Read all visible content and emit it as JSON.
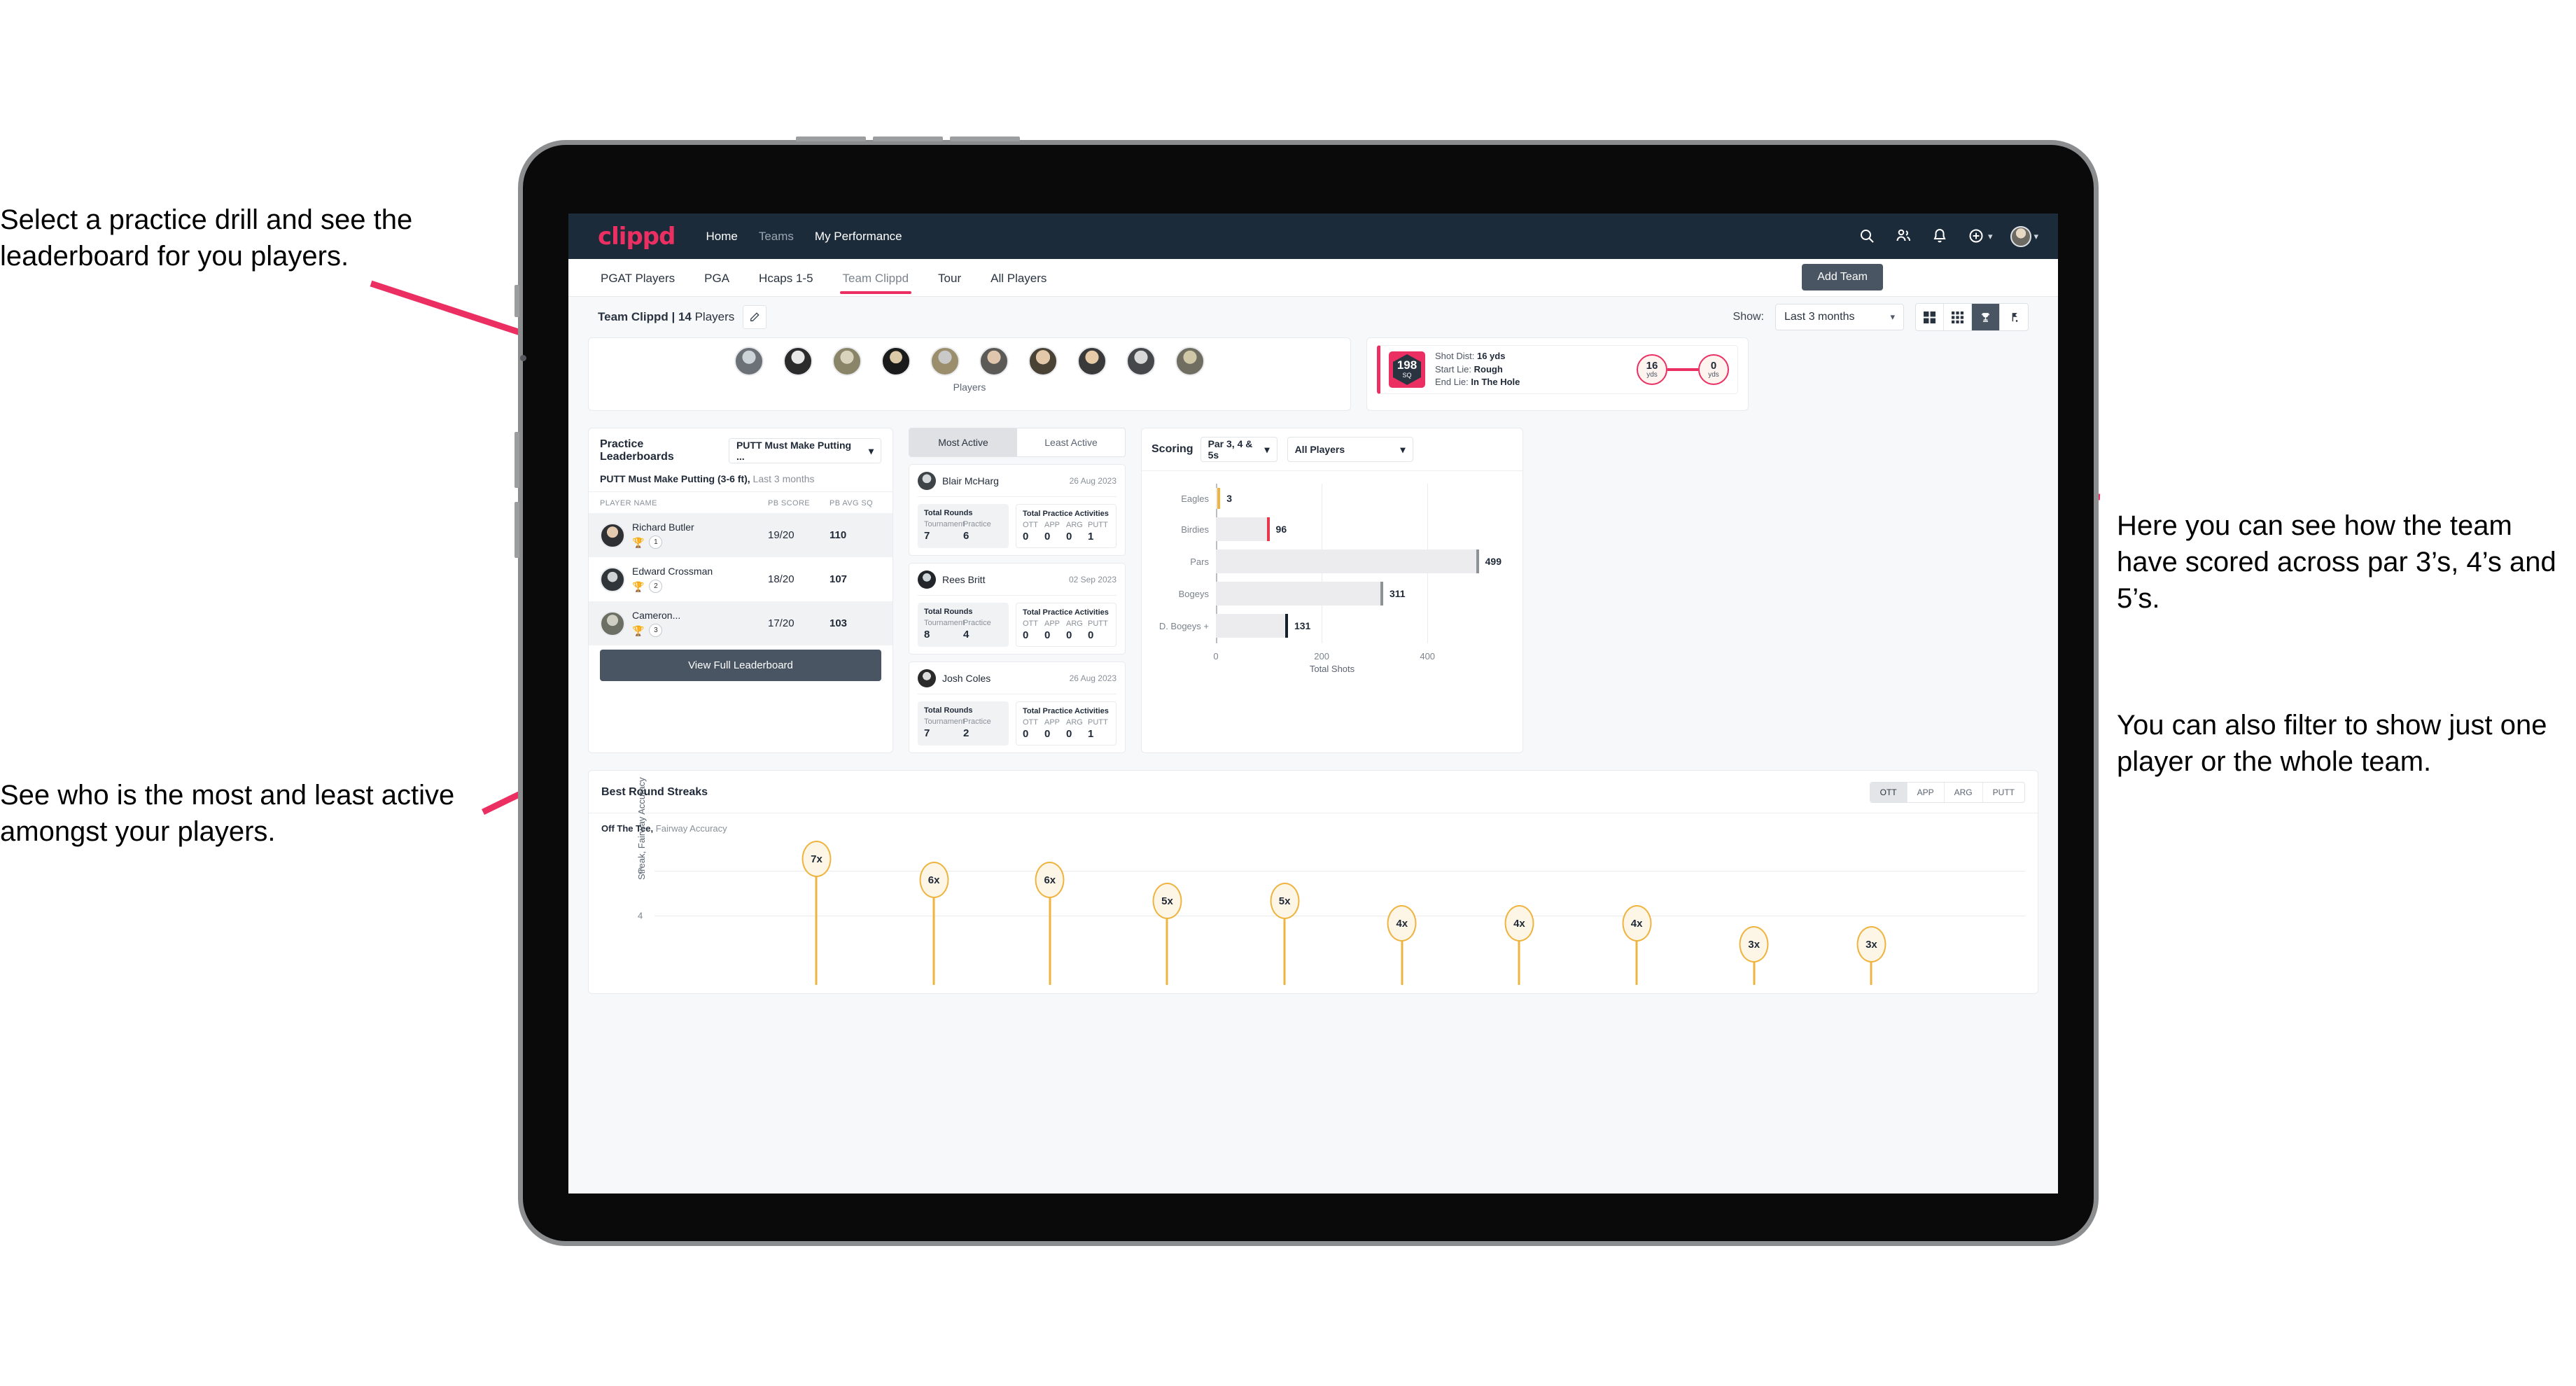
{
  "annotations": {
    "left_top": "Select a practice drill and see the leaderboard for you players.",
    "left_bottom": "See who is the most and least active amongst your players.",
    "right_top": "Here you can see how the team have scored across par 3’s, 4’s and 5’s.",
    "right_bottom": "You can also filter to show just one player or the whole team."
  },
  "app": {
    "brand": "clippd",
    "nav": [
      {
        "label": "Home",
        "active": true
      },
      {
        "label": "Teams",
        "active": false
      },
      {
        "label": "My Performance",
        "active": true
      }
    ],
    "icons": {
      "search": "search-icon",
      "people": "people-icon",
      "bell": "notification-bell-icon",
      "plus": "plus-circle-icon",
      "avatar": "user-avatar"
    },
    "tabs": [
      {
        "label": "PGAT Players",
        "active": false
      },
      {
        "label": "PGA",
        "active": false
      },
      {
        "label": "Hcaps 1-5",
        "active": false
      },
      {
        "label": "Team Clippd",
        "active": true
      },
      {
        "label": "Tour",
        "active": false
      },
      {
        "label": "All Players",
        "active": false
      }
    ],
    "add_team_label": "Add Team",
    "toolbar": {
      "team_name": "Team Clippd | 14",
      "team_players_suffix": " Players",
      "edit_icon": "pencil-icon",
      "show_label": "Show:",
      "show_value": "Last 3 months",
      "views": [
        {
          "name": "grid-large-view",
          "selected": false
        },
        {
          "name": "grid-small-view",
          "selected": false
        },
        {
          "name": "trophy-view",
          "selected": true
        },
        {
          "name": "golf-flag-view",
          "selected": false
        }
      ]
    }
  },
  "players_card": {
    "label": "Players",
    "count": 10
  },
  "shot_card": {
    "sq_value": "198",
    "sq_unit": "SQ",
    "lines": [
      {
        "label": "Shot Dist:",
        "value": "16 yds"
      },
      {
        "label": "Start Lie:",
        "value": "Rough"
      },
      {
        "label": "End Lie:",
        "value": "In The Hole"
      }
    ],
    "start": {
      "value": "16",
      "unit": "yds"
    },
    "end": {
      "value": "0",
      "unit": "yds"
    }
  },
  "practice_leaderboard": {
    "title": "Practice Leaderboards",
    "drill_select": "PUTT Must Make Putting ...",
    "subtitle_bold": "PUTT Must Make Putting (3-6 ft),",
    "subtitle_light": " Last 3 months",
    "columns": [
      "PLAYER NAME",
      "PB SCORE",
      "PB AVG SQ"
    ],
    "rows": [
      {
        "name": "Richard Butler",
        "rank": "1",
        "score": "19/20",
        "avg": "110",
        "trophy": "gold"
      },
      {
        "name": "Edward Crossman",
        "rank": "2",
        "score": "18/20",
        "avg": "107",
        "trophy": "silver"
      },
      {
        "name": "Cameron...",
        "rank": "3",
        "score": "17/20",
        "avg": "103",
        "trophy": "bronze"
      }
    ],
    "button": "View Full Leaderboard"
  },
  "activity": {
    "tabs": [
      {
        "label": "Most Active",
        "selected": true
      },
      {
        "label": "Least Active",
        "selected": false
      }
    ],
    "box_titles": {
      "rounds": "Total Rounds",
      "practice": "Total Practice Activities"
    },
    "rounds_heads": [
      "Tournament",
      "Practice"
    ],
    "practice_heads": [
      "OTT",
      "APP",
      "ARG",
      "PUTT"
    ],
    "cards": [
      {
        "name": "Blair McHarg",
        "date": "26 Aug 2023",
        "rounds": [
          "7",
          "6"
        ],
        "practice": [
          "0",
          "0",
          "0",
          "1"
        ]
      },
      {
        "name": "Rees Britt",
        "date": "02 Sep 2023",
        "rounds": [
          "8",
          "4"
        ],
        "practice": [
          "0",
          "0",
          "0",
          "0"
        ]
      },
      {
        "name": "Josh Coles",
        "date": "26 Aug 2023",
        "rounds": [
          "7",
          "2"
        ],
        "practice": [
          "0",
          "0",
          "0",
          "1"
        ]
      }
    ]
  },
  "scoring": {
    "title": "Scoring",
    "par_select": "Par 3, 4 & 5s",
    "player_select": "All Players"
  },
  "streaks": {
    "title": "Best Round Streaks",
    "buttons": [
      {
        "label": "OTT",
        "selected": true
      },
      {
        "label": "APP",
        "selected": false
      },
      {
        "label": "ARG",
        "selected": false
      },
      {
        "label": "PUTT",
        "selected": false
      }
    ],
    "sub_bold": "Off The Tee,",
    "sub_light": " Fairway Accuracy"
  },
  "chart_data": [
    {
      "type": "bar",
      "orientation": "horizontal",
      "title": "Scoring",
      "categories": [
        "Eagles",
        "Birdies",
        "Pars",
        "Bogeys",
        "D. Bogeys +"
      ],
      "values": [
        3,
        96,
        499,
        311,
        131
      ],
      "cap_colors": [
        "#eeb43f",
        "#e8384f",
        "#8d9297",
        "#8d9297",
        "#15202b"
      ],
      "xlabel": "Total Shots",
      "ylabel": "",
      "xticks": [
        0,
        200,
        400
      ],
      "xlim": [
        0,
        540
      ],
      "grid": true,
      "legend": "none"
    },
    {
      "type": "bar",
      "orientation": "vertical-lollipop",
      "title": "Best Round Streaks",
      "subtitle": "Off The Tee, Fairway Accuracy",
      "categories": [
        "1",
        "2",
        "3",
        "4",
        "5",
        "6",
        "7",
        "8",
        "9",
        "10"
      ],
      "values": [
        7,
        6,
        6,
        5,
        5,
        4,
        4,
        4,
        3,
        3
      ],
      "labels": [
        "7x",
        "6x",
        "6x",
        "5x",
        "5x",
        "4x",
        "4x",
        "4x",
        "3x",
        "3x"
      ],
      "ylabel": "Streak, Fairway Accuracy",
      "yticks": [
        4,
        6
      ],
      "ylim": [
        0,
        8
      ],
      "grid": true,
      "legend": "none"
    }
  ]
}
